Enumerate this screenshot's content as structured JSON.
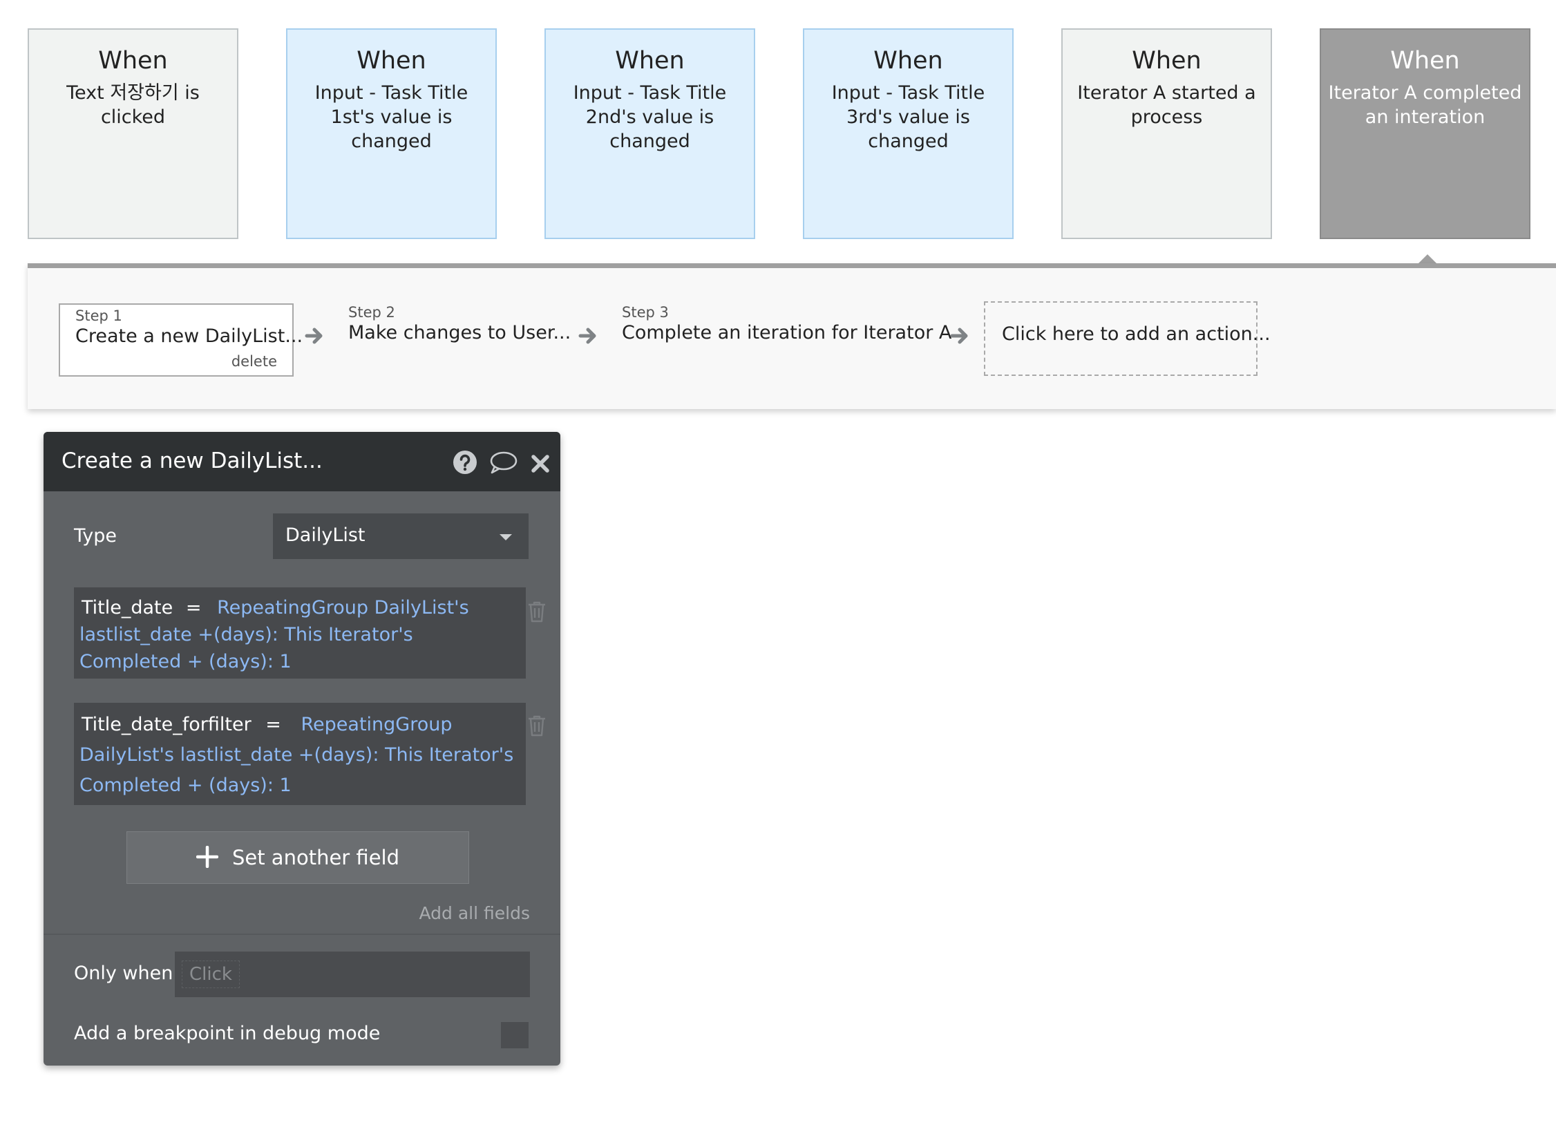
{
  "events": [
    {
      "when": "When",
      "desc": "Text 저장하기 is clicked"
    },
    {
      "when": "When",
      "desc": "Input - Task Title 1st's value is changed"
    },
    {
      "when": "When",
      "desc": "Input - Task Title 2nd's value is changed"
    },
    {
      "when": "When",
      "desc": "Input - Task Title 3rd's value is changed"
    },
    {
      "when": "When",
      "desc": "Iterator A started a process"
    },
    {
      "when": "When",
      "desc": "Iterator A completed an interation"
    }
  ],
  "workflow": {
    "steps": [
      {
        "num": "Step 1",
        "title": "Create a new DailyList...",
        "delete": "delete"
      },
      {
        "num": "Step 2",
        "title": "Make changes to User..."
      },
      {
        "num": "Step 3",
        "title": "Complete an iteration for Iterator A"
      }
    ],
    "add_action": "Click here to add an action..."
  },
  "panel": {
    "title": "Create a new DailyList...",
    "type_label": "Type",
    "type_value": "DailyList",
    "fields": [
      {
        "name": "Title_date",
        "eq": "=",
        "expr": "RepeatingGroup DailyList's lastlist_date +(days): This Iterator's Completed + (days): 1"
      },
      {
        "name": "Title_date_forfilter",
        "eq": "=",
        "expr": "RepeatingGroup DailyList's lastlist_date +(days): This Iterator's Completed + (days): 1"
      }
    ],
    "set_another_field": "Set another field",
    "add_all_fields": "Add all fields",
    "only_when_label": "Only when",
    "only_when_placeholder": "Click",
    "breakpoint_label": "Add a breakpoint in debug mode"
  },
  "colors": {
    "input_card": "#dff0fd",
    "selected_card": "#9e9e9e",
    "panel_bg": "#5f6265",
    "panel_header": "#2e3133",
    "expression": "#8db9f4"
  }
}
